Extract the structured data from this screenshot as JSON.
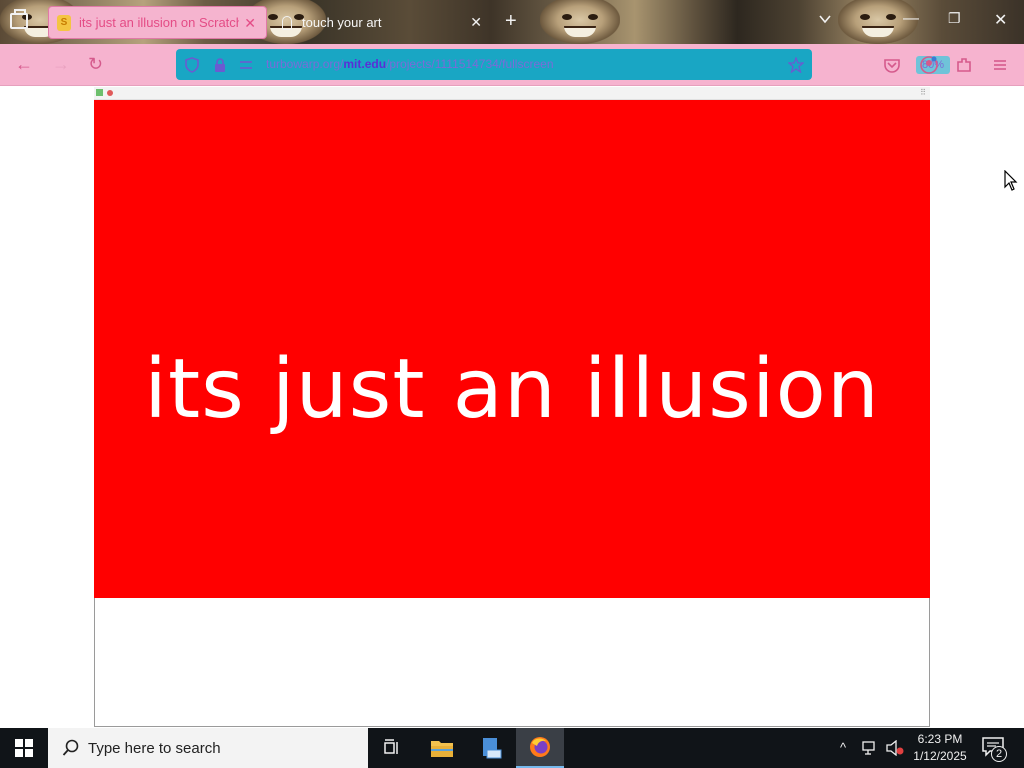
{
  "browser": {
    "tabs": [
      {
        "title": "its just an illusion on Scratch",
        "active": true,
        "favicon": "scratch-icon"
      },
      {
        "title": "touch your art",
        "active": false,
        "favicon": "page-icon"
      }
    ],
    "new_tab_label": "+",
    "url": {
      "prefix": "turbowarp.org/",
      "domain": "mit.edu",
      "suffix": "/projects/1111514734/fullscreen"
    },
    "zoom": "80%",
    "theme_colors": {
      "tab_active_bg": "#f5b4cf",
      "navbar_bg": "#f6b3cf",
      "urlbar_bg": "#19a6c4"
    }
  },
  "stage": {
    "text": "its just an illusion",
    "background": "#ff0000",
    "text_color": "#ffffff"
  },
  "taskbar": {
    "search_placeholder": "Type here to search",
    "apps": [
      "task-view-icon",
      "file-explorer-icon",
      "app-icon",
      "firefox-icon"
    ],
    "clock_time": "6:23 PM",
    "clock_date": "1/12/2025",
    "notification_count": "2"
  }
}
